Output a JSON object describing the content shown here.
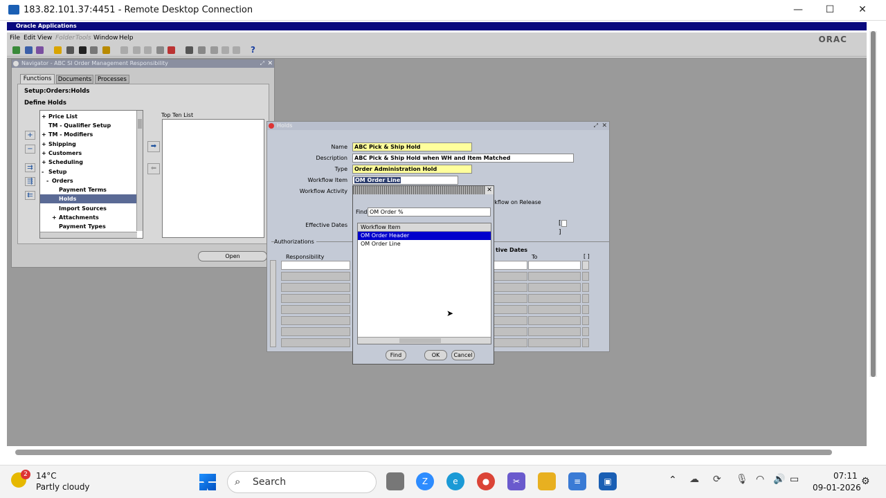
{
  "rdp": {
    "title": "183.82.101.37:4451 - Remote Desktop Connection",
    "minimize": "—",
    "maximize": "☐",
    "close": "✕"
  },
  "oa": {
    "title": "Oracle Applications",
    "menu": [
      "File",
      "Edit",
      "View",
      "Folder",
      "Tools",
      "Window",
      "Help"
    ],
    "logo": "ORAC"
  },
  "navigator": {
    "title": "Navigator - ABC SI Order Management Responsibility",
    "tabs": [
      "Functions",
      "Documents",
      "Processes"
    ],
    "path": "Setup:Orders:Holds",
    "current": "Define Holds",
    "top_ten_label": "Top Ten List",
    "open_label": "Open",
    "tree": [
      {
        "prefix": "+",
        "label": "Price List"
      },
      {
        "prefix": "",
        "label": "TM - Qualifier Setup"
      },
      {
        "prefix": "+",
        "label": "TM - Modifiers"
      },
      {
        "prefix": "+",
        "label": "Shipping"
      },
      {
        "prefix": "+",
        "label": "Customers"
      },
      {
        "prefix": "+",
        "label": "Scheduling"
      },
      {
        "prefix": "-",
        "label": "Setup"
      },
      {
        "prefix": "-",
        "label": "Orders"
      },
      {
        "prefix": "",
        "label": "Payment Terms"
      },
      {
        "prefix": "",
        "label": "Holds"
      },
      {
        "prefix": "",
        "label": "Import Sources"
      },
      {
        "prefix": "+",
        "label": "Attachments"
      },
      {
        "prefix": "",
        "label": "Payment Types"
      }
    ]
  },
  "holds": {
    "title": "Holds",
    "name_label": "Name",
    "name_value": "ABC Pick & Ship Hold",
    "desc_label": "Description",
    "desc_value": "ABC Pick & Ship Hold when WH and Item Matched",
    "type_label": "Type",
    "type_value": "Order Administration Hold",
    "wf_item_label": "Workflow Item",
    "wf_item_value": "OM Order Line",
    "wf_activity_label": "Workflow Activity",
    "release_label": "rkflow on Release",
    "eff_dates_label": "Effective Dates",
    "authorizations_label": "Authorizations",
    "responsibility_label": "Responsibility",
    "auth_eff_label": "tive Dates",
    "to_label": "To"
  },
  "lov": {
    "find_label": "Find",
    "find_value": "OM Order %",
    "column": "Workflow Item",
    "rows": [
      "OM Order Header",
      "OM Order Line"
    ],
    "selected": 0,
    "buttons": {
      "find": "Find",
      "ok": "OK",
      "cancel": "Cancel"
    }
  },
  "taskbar": {
    "weather_temp": "14°C",
    "weather_desc": "Partly cloudy",
    "weather_badge": "2",
    "search": "Search",
    "time": "07:11",
    "date": "09-01-2026"
  }
}
